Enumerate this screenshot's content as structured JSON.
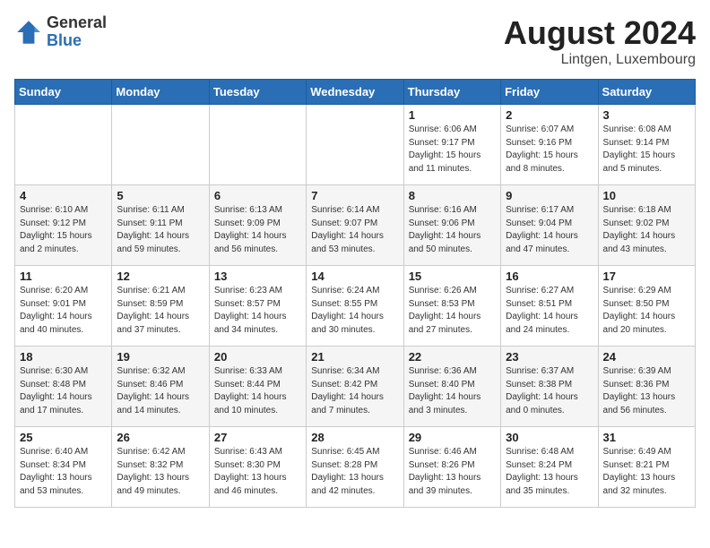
{
  "logo": {
    "general": "General",
    "blue": "Blue"
  },
  "title": "August 2024",
  "location": "Lintgen, Luxembourg",
  "days_of_week": [
    "Sunday",
    "Monday",
    "Tuesday",
    "Wednesday",
    "Thursday",
    "Friday",
    "Saturday"
  ],
  "weeks": [
    [
      {
        "day": "",
        "info": ""
      },
      {
        "day": "",
        "info": ""
      },
      {
        "day": "",
        "info": ""
      },
      {
        "day": "",
        "info": ""
      },
      {
        "day": "1",
        "info": "Sunrise: 6:06 AM\nSunset: 9:17 PM\nDaylight: 15 hours\nand 11 minutes."
      },
      {
        "day": "2",
        "info": "Sunrise: 6:07 AM\nSunset: 9:16 PM\nDaylight: 15 hours\nand 8 minutes."
      },
      {
        "day": "3",
        "info": "Sunrise: 6:08 AM\nSunset: 9:14 PM\nDaylight: 15 hours\nand 5 minutes."
      }
    ],
    [
      {
        "day": "4",
        "info": "Sunrise: 6:10 AM\nSunset: 9:12 PM\nDaylight: 15 hours\nand 2 minutes."
      },
      {
        "day": "5",
        "info": "Sunrise: 6:11 AM\nSunset: 9:11 PM\nDaylight: 14 hours\nand 59 minutes."
      },
      {
        "day": "6",
        "info": "Sunrise: 6:13 AM\nSunset: 9:09 PM\nDaylight: 14 hours\nand 56 minutes."
      },
      {
        "day": "7",
        "info": "Sunrise: 6:14 AM\nSunset: 9:07 PM\nDaylight: 14 hours\nand 53 minutes."
      },
      {
        "day": "8",
        "info": "Sunrise: 6:16 AM\nSunset: 9:06 PM\nDaylight: 14 hours\nand 50 minutes."
      },
      {
        "day": "9",
        "info": "Sunrise: 6:17 AM\nSunset: 9:04 PM\nDaylight: 14 hours\nand 47 minutes."
      },
      {
        "day": "10",
        "info": "Sunrise: 6:18 AM\nSunset: 9:02 PM\nDaylight: 14 hours\nand 43 minutes."
      }
    ],
    [
      {
        "day": "11",
        "info": "Sunrise: 6:20 AM\nSunset: 9:01 PM\nDaylight: 14 hours\nand 40 minutes."
      },
      {
        "day": "12",
        "info": "Sunrise: 6:21 AM\nSunset: 8:59 PM\nDaylight: 14 hours\nand 37 minutes."
      },
      {
        "day": "13",
        "info": "Sunrise: 6:23 AM\nSunset: 8:57 PM\nDaylight: 14 hours\nand 34 minutes."
      },
      {
        "day": "14",
        "info": "Sunrise: 6:24 AM\nSunset: 8:55 PM\nDaylight: 14 hours\nand 30 minutes."
      },
      {
        "day": "15",
        "info": "Sunrise: 6:26 AM\nSunset: 8:53 PM\nDaylight: 14 hours\nand 27 minutes."
      },
      {
        "day": "16",
        "info": "Sunrise: 6:27 AM\nSunset: 8:51 PM\nDaylight: 14 hours\nand 24 minutes."
      },
      {
        "day": "17",
        "info": "Sunrise: 6:29 AM\nSunset: 8:50 PM\nDaylight: 14 hours\nand 20 minutes."
      }
    ],
    [
      {
        "day": "18",
        "info": "Sunrise: 6:30 AM\nSunset: 8:48 PM\nDaylight: 14 hours\nand 17 minutes."
      },
      {
        "day": "19",
        "info": "Sunrise: 6:32 AM\nSunset: 8:46 PM\nDaylight: 14 hours\nand 14 minutes."
      },
      {
        "day": "20",
        "info": "Sunrise: 6:33 AM\nSunset: 8:44 PM\nDaylight: 14 hours\nand 10 minutes."
      },
      {
        "day": "21",
        "info": "Sunrise: 6:34 AM\nSunset: 8:42 PM\nDaylight: 14 hours\nand 7 minutes."
      },
      {
        "day": "22",
        "info": "Sunrise: 6:36 AM\nSunset: 8:40 PM\nDaylight: 14 hours\nand 3 minutes."
      },
      {
        "day": "23",
        "info": "Sunrise: 6:37 AM\nSunset: 8:38 PM\nDaylight: 14 hours\nand 0 minutes."
      },
      {
        "day": "24",
        "info": "Sunrise: 6:39 AM\nSunset: 8:36 PM\nDaylight: 13 hours\nand 56 minutes."
      }
    ],
    [
      {
        "day": "25",
        "info": "Sunrise: 6:40 AM\nSunset: 8:34 PM\nDaylight: 13 hours\nand 53 minutes."
      },
      {
        "day": "26",
        "info": "Sunrise: 6:42 AM\nSunset: 8:32 PM\nDaylight: 13 hours\nand 49 minutes."
      },
      {
        "day": "27",
        "info": "Sunrise: 6:43 AM\nSunset: 8:30 PM\nDaylight: 13 hours\nand 46 minutes."
      },
      {
        "day": "28",
        "info": "Sunrise: 6:45 AM\nSunset: 8:28 PM\nDaylight: 13 hours\nand 42 minutes."
      },
      {
        "day": "29",
        "info": "Sunrise: 6:46 AM\nSunset: 8:26 PM\nDaylight: 13 hours\nand 39 minutes."
      },
      {
        "day": "30",
        "info": "Sunrise: 6:48 AM\nSunset: 8:24 PM\nDaylight: 13 hours\nand 35 minutes."
      },
      {
        "day": "31",
        "info": "Sunrise: 6:49 AM\nSunset: 8:21 PM\nDaylight: 13 hours\nand 32 minutes."
      }
    ]
  ]
}
